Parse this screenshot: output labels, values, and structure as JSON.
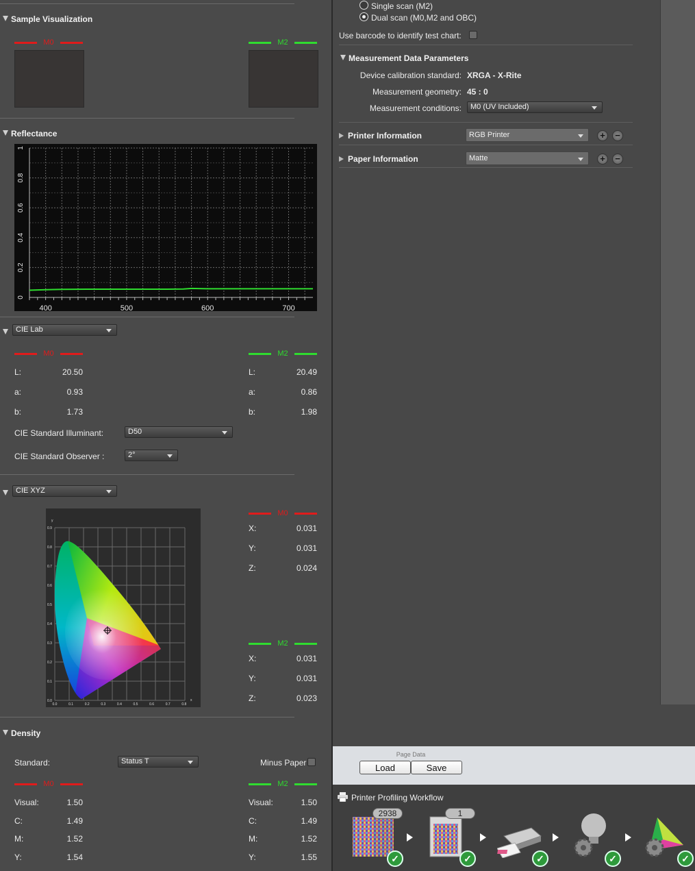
{
  "colors": {
    "m0": "#e01b1b",
    "m2": "#2fdc2f",
    "panel": "#4a4a4a"
  },
  "sample": {
    "title": "Sample Visualization",
    "m0": "M0",
    "m2": "M2"
  },
  "reflectance": {
    "title": "Reflectance"
  },
  "chart_data": {
    "type": "line",
    "title": "",
    "xlabel": "",
    "ylabel": "",
    "x_ticks": [
      400,
      500,
      600,
      700
    ],
    "y_ticks": [
      "0",
      "0.2",
      "0.4",
      "0.6",
      "0.8",
      "1"
    ],
    "xlim": [
      380,
      730
    ],
    "ylim": [
      0,
      1
    ],
    "grid": true,
    "series": [
      {
        "color": "#2fdc2f",
        "x": [
          380,
          390,
          400,
          420,
          450,
          500,
          550,
          570,
          580,
          600,
          650,
          700,
          730
        ],
        "y": [
          0.048,
          0.05,
          0.052,
          0.054,
          0.055,
          0.055,
          0.055,
          0.056,
          0.06,
          0.058,
          0.058,
          0.058,
          0.058
        ]
      }
    ]
  },
  "lab": {
    "dropdown": "CIE Lab",
    "m0_title": "M0",
    "m2_title": "M2",
    "m0": [
      {
        "k": "L:",
        "v": "20.50"
      },
      {
        "k": "a:",
        "v": "0.93"
      },
      {
        "k": "b:",
        "v": "1.73"
      }
    ],
    "m2": [
      {
        "k": "L:",
        "v": "20.49"
      },
      {
        "k": "a:",
        "v": "0.86"
      },
      {
        "k": "b:",
        "v": "1.98"
      }
    ],
    "illuminant_label": "CIE Standard Illuminant:",
    "illuminant_value": "D50",
    "observer_label": "CIE Standard Observer :",
    "observer_value": "2°"
  },
  "xyz": {
    "dropdown": "CIE XYZ",
    "m0_title": "M0",
    "m2_title": "M2",
    "m0": [
      {
        "k": "X:",
        "v": "0.031"
      },
      {
        "k": "Y:",
        "v": "0.031"
      },
      {
        "k": "Z:",
        "v": "0.024"
      }
    ],
    "m2": [
      {
        "k": "X:",
        "v": "0.031"
      },
      {
        "k": "Y:",
        "v": "0.031"
      },
      {
        "k": "Z:",
        "v": "0.023"
      }
    ],
    "axis_x_ticks": [
      "0.0",
      "0.1",
      "0.2",
      "0.3",
      "0.4",
      "0.5",
      "0.6",
      "0.7",
      "0.8"
    ],
    "axis_y_ticks": [
      "0.9",
      "0.8",
      "0.7",
      "0.6",
      "0.5",
      "0.4",
      "0.3",
      "0.2",
      "0.1",
      "0.0"
    ],
    "axis_x_name": "x",
    "axis_y_name": "y"
  },
  "density": {
    "title": "Density",
    "standard_label": "Standard:",
    "standard_value": "Status T",
    "minus_paper": "Minus Paper",
    "m0_title": "M0",
    "m2_title": "M2",
    "m0": [
      {
        "k": "Visual:",
        "v": "1.50"
      },
      {
        "k": "C:",
        "v": "1.49"
      },
      {
        "k": "M:",
        "v": "1.52"
      },
      {
        "k": "Y:",
        "v": "1.54"
      }
    ],
    "m2": [
      {
        "k": "Visual:",
        "v": "1.50"
      },
      {
        "k": "C:",
        "v": "1.49"
      },
      {
        "k": "M:",
        "v": "1.52"
      },
      {
        "k": "Y:",
        "v": "1.55"
      }
    ]
  },
  "scan": {
    "single": "Single scan (M2)",
    "dual": "Dual scan (M0,M2 and OBC)",
    "selected": "dual",
    "barcode": "Use barcode to identify test chart:"
  },
  "params": {
    "title": "Measurement Data Parameters",
    "calib_label": "Device calibration standard:",
    "calib_value": "XRGA - X-Rite",
    "geom_label": "Measurement geometry:",
    "geom_value": "45 : 0",
    "cond_label": "Measurement conditions:",
    "cond_value": "M0 (UV Included)"
  },
  "printer": {
    "title": "Printer Information",
    "value": "RGB Printer"
  },
  "paper": {
    "title": "Paper Information",
    "value": "Matte"
  },
  "page_data": {
    "title": "Page Data",
    "load": "Load",
    "save": "Save"
  },
  "workflow": {
    "title": "Printer Profiling Workflow",
    "steps": [
      {
        "icon": "test-chart-icon",
        "count": "2938"
      },
      {
        "icon": "printed-chart-icon",
        "count": "1"
      },
      {
        "icon": "scanner-icon"
      },
      {
        "icon": "lightbulb-gear-icon"
      },
      {
        "icon": "profile-gear-icon"
      }
    ]
  }
}
